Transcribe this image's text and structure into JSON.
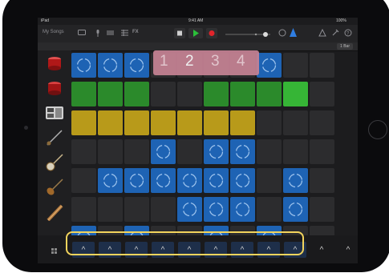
{
  "status": {
    "device": "iPad",
    "time": "9:41 AM",
    "battery": "100%"
  },
  "toolbar": {
    "my_songs": "My Songs",
    "fx": "FX",
    "icons": [
      "browser-icon",
      "mic-icon",
      "mixer-icon",
      "grid-icon",
      "fx-icon",
      "stop-icon",
      "play-icon",
      "record-icon",
      "volume-icon",
      "tuner-icon",
      "loop-icon",
      "settings-icon",
      "help-icon"
    ],
    "colors": {
      "play": "#2bbf3a",
      "record": "#e0242b",
      "accent": "#1e63b4"
    }
  },
  "ruler": {
    "bar_label": "1 Bar"
  },
  "countin": {
    "digits": [
      "1",
      "2",
      "3",
      "4"
    ],
    "active_index": 1
  },
  "instruments": [
    "drum-kit-red-icon",
    "drum-machine-red-icon",
    "beat-sequencer-icon",
    "bass-icon",
    "banjo-icon",
    "violin-icon",
    "erhu-icon"
  ],
  "grid": {
    "rows": [
      [
        "blue",
        "blue",
        "blue",
        "",
        "",
        "",
        "",
        "blue",
        "",
        ""
      ],
      [
        "green",
        "green",
        "green",
        "",
        "",
        "green",
        "green",
        "green",
        "green-bright",
        ""
      ],
      [
        "yellow",
        "yellow",
        "yellow",
        "yellow",
        "yellow",
        "yellow",
        "yellow",
        "",
        "",
        ""
      ],
      [
        "",
        "",
        "",
        "blue",
        "",
        "blue",
        "blue",
        "",
        "",
        ""
      ],
      [
        "",
        "blue",
        "blue",
        "blue",
        "blue",
        "blue",
        "blue",
        "",
        "blue",
        ""
      ],
      [
        "",
        "",
        "",
        "",
        "blue",
        "blue",
        "blue",
        "",
        "blue",
        ""
      ],
      [
        "blue",
        "",
        "blue",
        "",
        "",
        "blue",
        "",
        "blue",
        "",
        ""
      ]
    ]
  },
  "triggers": {
    "count": 11,
    "glyph": "^"
  },
  "highlight_color": "#f2d45c"
}
